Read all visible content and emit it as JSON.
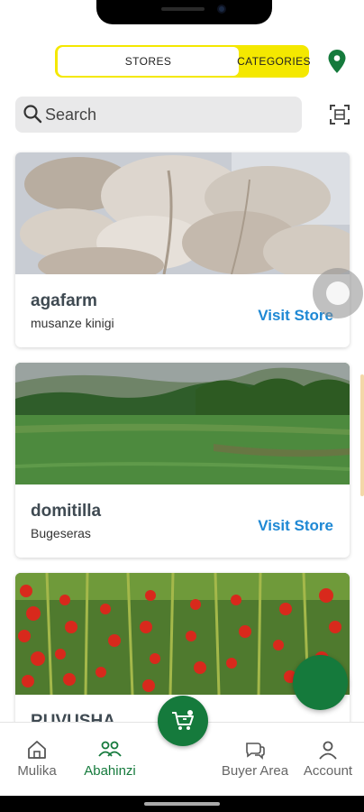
{
  "toggle": {
    "stores_label": "STORES",
    "categories_label": "CATEGORIES"
  },
  "search": {
    "placeholder": "Search"
  },
  "stores": [
    {
      "name": "agafarm",
      "location": "musanze kinigi",
      "action": "Visit Store",
      "image": "oyster-mushrooms"
    },
    {
      "name": "domitilla",
      "location": "Bugeseras",
      "action": "Visit Store",
      "image": "green-field"
    },
    {
      "name": "RUVUSHA",
      "location": "",
      "action": "",
      "image": "cherry-tomatoes"
    }
  ],
  "nav": {
    "items": [
      {
        "label": "Mulika",
        "icon": "home-icon"
      },
      {
        "label": "Abahinzi",
        "icon": "farmers-icon",
        "active": true
      },
      {
        "label": "Buyer Area",
        "icon": "chat-icon"
      },
      {
        "label": "Account",
        "icon": "person-icon"
      }
    ],
    "center_icon": "cart-icon"
  },
  "colors": {
    "brand_green": "#157a3c",
    "toggle_yellow": "#f4e800",
    "link_blue": "#1e88d4"
  }
}
